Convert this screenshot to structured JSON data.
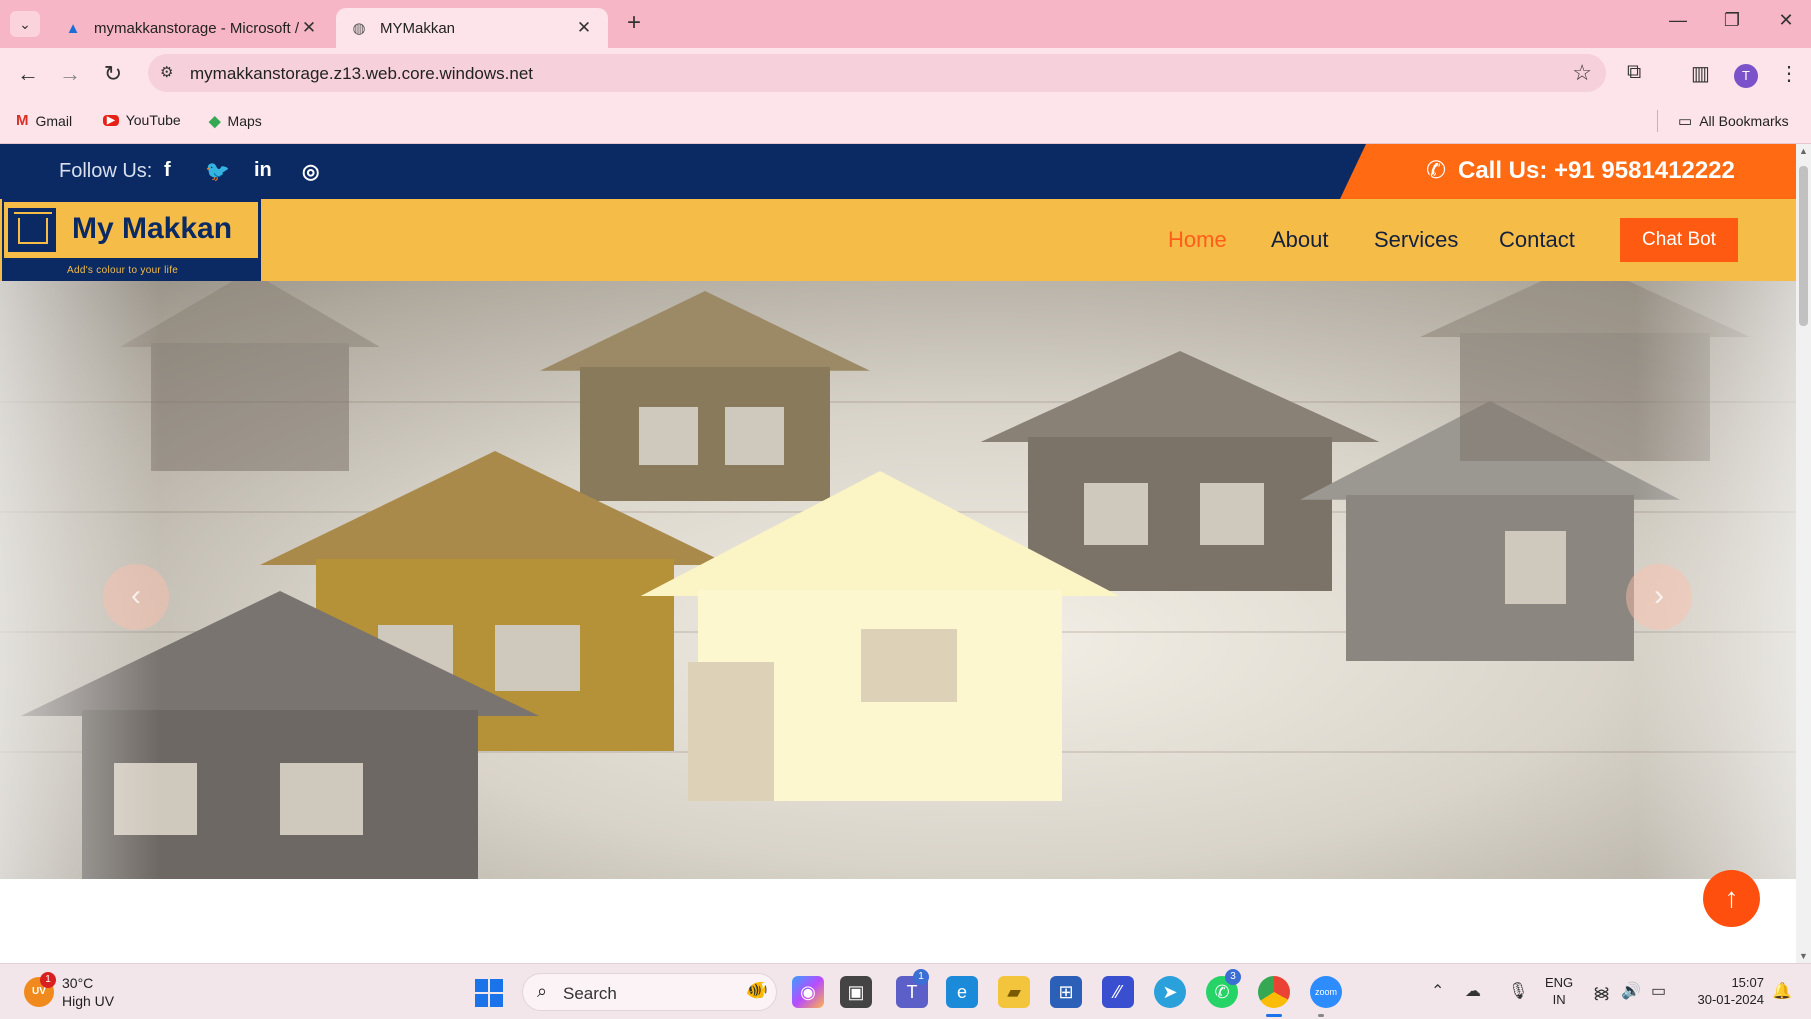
{
  "browser": {
    "tabs": [
      {
        "title": "mymakkanstorage - Microsoft /",
        "favicon": "azure-icon",
        "active": false
      },
      {
        "title": "MYMakkan",
        "favicon": "globe-icon",
        "active": true
      }
    ],
    "url": "mymakkanstorage.z13.web.core.windows.net",
    "profile_initial": "T",
    "bookmarks": [
      {
        "label": "Gmail",
        "icon": "gmail-icon"
      },
      {
        "label": "YouTube",
        "icon": "youtube-icon"
      },
      {
        "label": "Maps",
        "icon": "maps-icon"
      }
    ],
    "all_bookmarks": "All Bookmarks"
  },
  "site": {
    "topbar": {
      "follow_label": "Follow Us:",
      "social": [
        "facebook-icon",
        "twitter-icon",
        "linkedin-icon",
        "instagram-icon"
      ],
      "call_text": "Call Us: +91 9581412222"
    },
    "logo": {
      "name": "My Makkan",
      "tagline": "Add's colour to your life"
    },
    "nav": {
      "items": [
        "Home",
        "About",
        "Services",
        "Contact"
      ],
      "active": "Home",
      "chat_bot": "Chat Bot"
    },
    "hero": {
      "prev_label": "‹",
      "next_label": "›"
    },
    "scroll_top_label": "↑"
  },
  "taskbar": {
    "weather_temp": "30°C",
    "weather_desc": "High UV",
    "weather_badge": "1",
    "weather_icon_text": "UV",
    "search_label": "Search",
    "teams_badge": "1",
    "whatsapp_badge": "3",
    "lang_line1": "ENG",
    "lang_line2": "IN",
    "time": "15:07",
    "date": "30-01-2024"
  },
  "colors": {
    "navy": "#0b2a63",
    "amber": "#f5bd48",
    "orange": "#ff5a11",
    "tab_bar": "#f7b6c5"
  }
}
